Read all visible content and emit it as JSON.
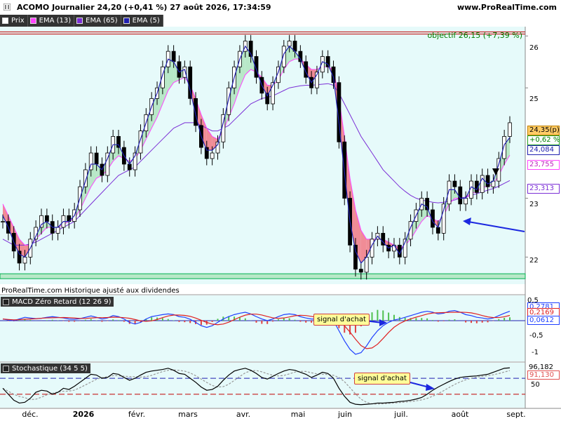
{
  "header": {
    "title": "ACOMO Journalier 24,20 (+0,41 %) 27 août 2026, 17:34:59",
    "site": "www.ProRealTime.com"
  },
  "legend": [
    {
      "label": "Prix",
      "color": "#ffffff"
    },
    {
      "label": "EMA (13)",
      "color": "#ff44ff"
    },
    {
      "label": "EMA (65)",
      "color": "#7b2fd6"
    },
    {
      "label": "EMA (5)",
      "color": "#2020b0"
    }
  ],
  "price_labels": {
    "objectif": "objectif 26,15 (+7,39 %)",
    "last": "24,35(p)",
    "change": "+0,62 %",
    "ema5": "24,084",
    "ema13": "23,755",
    "ema65": "23,313"
  },
  "note": "ProRealTime.com  Historique ajusté aux dividendes",
  "macd": {
    "title": "MACD Zéro Retard (12 26 9)",
    "values": [
      "0,2781",
      "0,2169",
      "0,0612"
    ],
    "ticks": [
      "0,5",
      "-0,5",
      "-1"
    ]
  },
  "stoch": {
    "title": "Stochastique (34 5 5)",
    "values": [
      "96,182",
      "91,130"
    ],
    "ticks": [
      "50"
    ]
  },
  "callouts": {
    "macd": "signal d'achat",
    "stoch": "signal d'achat"
  },
  "colors": {
    "background": "#e6fafa",
    "bullish_cloud": "#b8e8c8",
    "bearish_cloud": "#f08c96",
    "ema13": "#ff44ff",
    "ema65": "#7b2fd6",
    "ema5": "#2020b0",
    "arrow": "#1c28e0",
    "support": "#00b050",
    "resistance": "#c00000"
  },
  "chart_data": {
    "type": "line",
    "x_ticks": [
      "déc.",
      "2026",
      "févr.",
      "mars",
      "avr.",
      "mai",
      "juin",
      "juil.",
      "août",
      "sept."
    ],
    "y_ticks": [
      "22",
      "23",
      "25",
      "26"
    ],
    "ylim": [
      21.6,
      26.1
    ],
    "resistance_level": 26.08,
    "support_level": 21.69,
    "objectif": 26.15,
    "series": [
      {
        "name": "Prix",
        "values": [
          22.6,
          22.4,
          22.1,
          21.9,
          22.0,
          22.3,
          22.5,
          22.7,
          22.6,
          22.4,
          22.5,
          22.7,
          22.6,
          22.8,
          23.2,
          23.5,
          23.8,
          23.6,
          23.4,
          23.8,
          24.1,
          23.9,
          23.6,
          23.5,
          23.8,
          24.2,
          24.5,
          24.8,
          25.0,
          25.4,
          25.7,
          25.5,
          25.2,
          25.4,
          24.8,
          24.3,
          23.9,
          23.7,
          23.8,
          24.0,
          24.5,
          25.0,
          25.4,
          25.7,
          25.9,
          25.6,
          25.2,
          24.9,
          24.7,
          25.1,
          25.4,
          25.8,
          25.9,
          25.7,
          25.5,
          25.2,
          25.0,
          25.3,
          25.6,
          25.4,
          25.1,
          24.0,
          23.0,
          22.2,
          21.8,
          21.75,
          22.0,
          22.3,
          22.4,
          22.2,
          22.1,
          22.2,
          22.0,
          22.3,
          22.6,
          22.8,
          23.0,
          22.8,
          22.5,
          22.4,
          22.9,
          23.3,
          23.2,
          22.9,
          23.0,
          23.3,
          23.1,
          23.4,
          23.2,
          23.3,
          23.7,
          24.1,
          24.35
        ]
      },
      {
        "name": "EMA (5)",
        "values": [
          22.7,
          22.5,
          22.25,
          22.05,
          22.0,
          22.15,
          22.35,
          22.55,
          22.6,
          22.5,
          22.5,
          22.6,
          22.6,
          22.7,
          23.0,
          23.3,
          23.6,
          23.6,
          23.5,
          23.7,
          23.95,
          23.95,
          23.75,
          23.6,
          23.75,
          24.05,
          24.35,
          24.65,
          24.9,
          25.25,
          25.55,
          25.5,
          25.3,
          25.35,
          24.95,
          24.5,
          24.1,
          23.85,
          23.85,
          23.95,
          24.35,
          24.8,
          25.2,
          25.55,
          25.8,
          25.65,
          25.35,
          25.05,
          24.85,
          25.05,
          25.3,
          25.65,
          25.8,
          25.7,
          25.55,
          25.3,
          25.1,
          25.25,
          25.5,
          25.45,
          25.2,
          24.35,
          23.45,
          22.6,
          22.1,
          21.9,
          22.0,
          22.2,
          22.35,
          22.25,
          22.15,
          22.2,
          22.05,
          22.25,
          22.5,
          22.7,
          22.9,
          22.85,
          22.6,
          22.5,
          22.8,
          23.15,
          23.15,
          23.0,
          23.0,
          23.2,
          23.15,
          23.35,
          23.25,
          23.3,
          23.6,
          23.95,
          24.08
        ]
      },
      {
        "name": "EMA (13)",
        "values": [
          22.9,
          22.7,
          22.5,
          22.3,
          22.2,
          22.2,
          22.3,
          22.4,
          22.5,
          22.5,
          22.5,
          22.55,
          22.6,
          22.65,
          22.8,
          23.0,
          23.2,
          23.35,
          23.4,
          23.5,
          23.65,
          23.75,
          23.7,
          23.65,
          23.7,
          23.85,
          24.05,
          24.25,
          24.45,
          24.7,
          24.95,
          25.1,
          25.15,
          25.2,
          25.05,
          24.8,
          24.5,
          24.25,
          24.1,
          24.05,
          24.2,
          24.45,
          24.7,
          25.0,
          25.25,
          25.35,
          25.3,
          25.2,
          25.05,
          25.05,
          25.15,
          25.35,
          25.5,
          25.55,
          25.55,
          25.45,
          25.35,
          25.35,
          25.4,
          25.4,
          25.35,
          24.8,
          24.1,
          23.35,
          22.8,
          22.45,
          22.3,
          22.3,
          22.3,
          22.3,
          22.25,
          22.2,
          22.15,
          22.2,
          22.3,
          22.45,
          22.6,
          22.7,
          22.65,
          22.6,
          22.7,
          22.9,
          23.0,
          23.0,
          23.0,
          23.1,
          23.1,
          23.2,
          23.2,
          23.25,
          23.4,
          23.6,
          23.76
        ]
      },
      {
        "name": "EMA (65)",
        "values": [
          22.3,
          22.25,
          22.2,
          22.2,
          22.2,
          22.22,
          22.25,
          22.3,
          22.35,
          22.4,
          22.45,
          22.5,
          22.55,
          22.6,
          22.7,
          22.8,
          22.9,
          23.0,
          23.1,
          23.2,
          23.3,
          23.4,
          23.45,
          23.5,
          23.55,
          23.65,
          23.75,
          23.85,
          23.95,
          24.05,
          24.15,
          24.25,
          24.3,
          24.35,
          24.35,
          24.35,
          24.3,
          24.25,
          24.2,
          24.2,
          24.25,
          24.3,
          24.4,
          24.5,
          24.6,
          24.7,
          24.75,
          24.8,
          24.82,
          24.85,
          24.9,
          24.95,
          25.0,
          25.02,
          25.04,
          25.05,
          25.05,
          25.06,
          25.07,
          25.08,
          25.05,
          24.9,
          24.7,
          24.5,
          24.3,
          24.1,
          23.95,
          23.8,
          23.65,
          23.5,
          23.4,
          23.3,
          23.2,
          23.12,
          23.05,
          23.0,
          22.97,
          22.95,
          22.93,
          22.92,
          22.93,
          22.95,
          22.97,
          23.0,
          23.02,
          23.05,
          23.08,
          23.11,
          23.14,
          23.17,
          23.21,
          23.26,
          23.31
        ]
      }
    ]
  }
}
